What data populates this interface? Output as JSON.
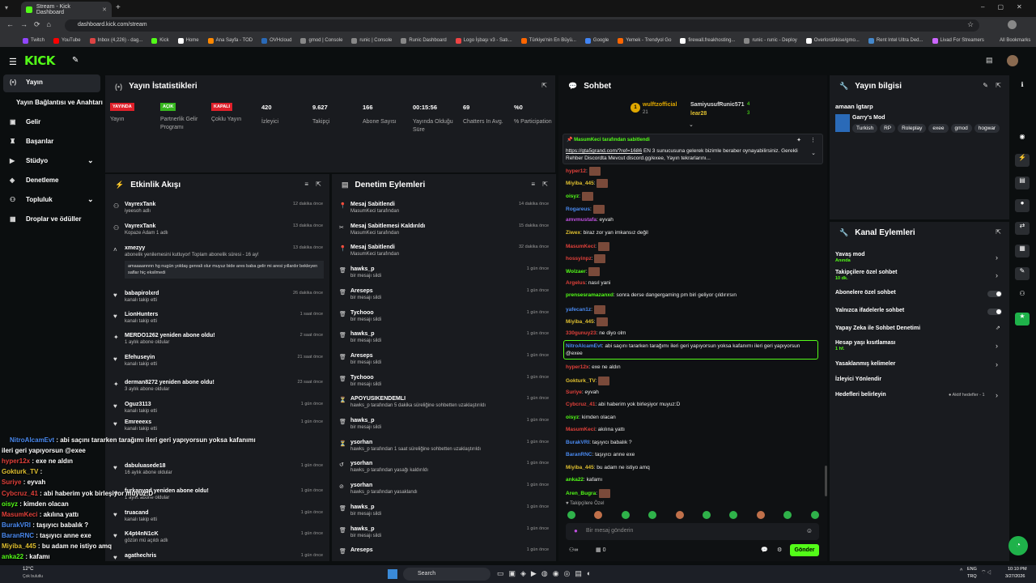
{
  "browser": {
    "tab_title": "Stream - Kick Dashboard",
    "url": "dashboard.kick.com/stream",
    "bookmarks": [
      "Twitch",
      "YouTube",
      "Inbox (4,226) - dag...",
      "Kick",
      "Home",
      "Ana Sayfa - TOD",
      "OVHcloud",
      "gmod | Console",
      "runic | Console",
      "Runic Dashboard",
      "Logo İşbaşı v3 - Satı...",
      "Türkiye'nin En Büyü...",
      "Google",
      "Yemek - Trendyol Go",
      "firewall.freakhosting...",
      "runic - runic - Deploy",
      "OverlordAkise/gmo...",
      "Rent Intel Ultra Ded...",
      "Livad For Streamers"
    ],
    "all_bookmarks": "All Bookmarks"
  },
  "brand": {
    "logo": "KICK",
    "accent": "#53fc18"
  },
  "sidebar": {
    "items": [
      {
        "label": "Yayın",
        "icon": "broadcast-icon"
      },
      {
        "label": "Yayın Bağlantısı ve Anahtarı",
        "icon": "key-icon"
      },
      {
        "label": "Gelir",
        "icon": "money-icon"
      },
      {
        "label": "Başarılar",
        "icon": "trophy-icon"
      },
      {
        "label": "Stüdyo",
        "icon": "studio-icon"
      },
      {
        "label": "Denetleme",
        "icon": "shield-icon"
      },
      {
        "label": "Topluluk",
        "icon": "users-icon"
      },
      {
        "label": "Droplar ve ödüller",
        "icon": "gift-icon"
      }
    ]
  },
  "stats": {
    "title": "Yayın İstatistikleri",
    "items": [
      {
        "badge": "YAYINDA",
        "label": "Yayın",
        "color": "#e0202a"
      },
      {
        "badge": "AÇIK",
        "label": "Partnerlik Gelir Programı",
        "color": "#36b71e"
      },
      {
        "badge": "KAPALI",
        "label": "Çoklu Yayın",
        "color": "#e0202a"
      },
      {
        "value": "420",
        "label": "İzleyici"
      },
      {
        "value": "9.627",
        "label": "Takipçi"
      },
      {
        "value": "166",
        "label": "Abone Sayısı"
      },
      {
        "value": "00:15:56",
        "label": "Yayında Olduğu Süre"
      },
      {
        "value": "69",
        "label": "Chatters In Avg."
      },
      {
        "value": "%0",
        "label": "% Participation"
      }
    ]
  },
  "activity": {
    "title": "Etkinlik Akışı",
    "items": [
      {
        "name": "VayrexTank",
        "sub": "iyeesoh adlı",
        "time": "12 dakika önce"
      },
      {
        "name": "VayrexTank",
        "sub": "Kopaze Adam 1 adlı",
        "time": "13 dakika önce"
      },
      {
        "name": "xmezyy",
        "sub": "abonelik yenilemesini kutluyor! Toplam abonelik süresi - 16 ay!",
        "time": "13 dakika önce",
        "msg": "amaaaannnn hg nugün yoldaş genrali olur muyuz bide ares baba gelir mi aresi yıllardır bekleyen saflar hiç eksilmedi"
      },
      {
        "name": "babapirolxrd",
        "sub": "kanalı takip etti",
        "time": "26 dakika önce"
      },
      {
        "name": "LionHunters",
        "sub": "kanalı takip etti",
        "time": "1 saat önce"
      },
      {
        "name": "MERDO1262 yeniden abone oldu!",
        "sub": "1 aylık abone oldular",
        "time": "2 saat önce"
      },
      {
        "name": "Efehuseyin",
        "sub": "kanalı takip etti",
        "time": "21 saat önce"
      },
      {
        "name": "derman8272 yeniden abone oldu!",
        "sub": "3 aylık abone oldular",
        "time": "23 saat önce"
      },
      {
        "name": "Oguz3113",
        "sub": "kanalı takip etti",
        "time": "1 gün önce"
      },
      {
        "name": "Emreeexs",
        "sub": "kanalı takip etti",
        "time": "1 gün önce"
      },
      {
        "name": "dabuluasede18",
        "sub": "16 aylık abone oldular",
        "time": "1 gün önce"
      },
      {
        "name": "furkanygd yeniden abone oldu!",
        "sub": "1 aylık abone oldular",
        "time": "1 gün önce"
      },
      {
        "name": "truacand",
        "sub": "kanalı takip etti",
        "time": "1 gün önce"
      },
      {
        "name": "K4pt4nN1cK",
        "sub": "gözün mü açıldı adlı",
        "time": "1 gün önce"
      },
      {
        "name": "agathechris",
        "sub": "",
        "time": "1 gün önce"
      }
    ]
  },
  "modlog": {
    "title": "Denetim Eylemleri",
    "items": [
      {
        "name": "Mesaj Sabitlendi",
        "sub": "MasumKeci tarafından",
        "time": "14 dakika önce",
        "icon": "pin-icon"
      },
      {
        "name": "Mesaj Sabitlemesi Kaldırıldı",
        "sub": "MasumKeci tarafından",
        "time": "15 dakika önce",
        "icon": "unpin-icon"
      },
      {
        "name": "Mesaj Sabitlendi",
        "sub": "MasumKeci tarafından",
        "time": "32 dakika önce",
        "icon": "pin-icon"
      },
      {
        "name": "hawks_p",
        "sub": "bir mesajı sildi",
        "time": "1 gün önce",
        "icon": "trash-icon"
      },
      {
        "name": "Areseps",
        "sub": "bir mesajı sildi",
        "time": "1 gün önce",
        "icon": "trash-icon"
      },
      {
        "name": "Tychooo",
        "sub": "bir mesajı sildi",
        "time": "1 gün önce",
        "icon": "trash-icon"
      },
      {
        "name": "hawks_p",
        "sub": "bir mesajı sildi",
        "time": "1 gün önce",
        "icon": "trash-icon"
      },
      {
        "name": "Areseps",
        "sub": "bir mesajı sildi",
        "time": "1 gün önce",
        "icon": "trash-icon"
      },
      {
        "name": "Tychooo",
        "sub": "bir mesajı sildi",
        "time": "1 gün önce",
        "icon": "trash-icon"
      },
      {
        "name": "APOYUSIKENDEMLI",
        "sub": "hawks_p tarafından 5 dakika süreliğine sohbetten uzaklaştırıldı",
        "time": "1 gün önce",
        "icon": "timeout-icon"
      },
      {
        "name": "hawks_p",
        "sub": "bir mesajı sildi",
        "time": "1 gün önce",
        "icon": "trash-icon"
      },
      {
        "name": "ysorhan",
        "sub": "hawks_p tarafından 1 saat süreliğine sohbetten uzaklaştırıldı",
        "time": "1 gün önce",
        "icon": "timeout-icon"
      },
      {
        "name": "ysorhan",
        "sub": "hawks_p tarafından yasağı kaldırıldı",
        "time": "1 gün önce",
        "icon": "unban-icon"
      },
      {
        "name": "ysorhan",
        "sub": "hawks_p tarafından yasaklandı",
        "time": "1 gün önce",
        "icon": "ban-icon"
      },
      {
        "name": "hawks_p",
        "sub": "bir mesajı sildi",
        "time": "1 gün önce",
        "icon": "trash-icon"
      },
      {
        "name": "hawks_p",
        "sub": "bir mesajı sildi",
        "time": "1 gün önce",
        "icon": "trash-icon"
      },
      {
        "name": "Areseps",
        "sub": "",
        "time": "1 gün önce",
        "icon": "trash-icon"
      }
    ]
  },
  "chat": {
    "title": "Sohbet",
    "top_gifter1": {
      "name": "wulftzofficial",
      "count": "21"
    },
    "top_gifter2": {
      "name": "SamiyusufRunic571",
      "count": "4"
    },
    "top_gifter3": {
      "name": "lear28",
      "count": "3"
    },
    "pinned_by": "MasumKeci tarafından sabitlendi",
    "pinned_link": "https://gta5grand.com/?ref=1686",
    "pinned_text": "EN 3 sunucusuna gelerek bizimle beraber oynayabilirsiniz. Gerekli Rehber Discordta Mevcut discord.gg/exee, Yayın tekrarlarını...",
    "messages": [
      {
        "user": "hyper12",
        "text": "",
        "color": "#e0403a"
      },
      {
        "user": "Miyiba_445",
        "text": "",
        "color": "#e0c030"
      },
      {
        "user": "oisyz",
        "text": "",
        "color": "#53fc18"
      },
      {
        "user": "Rogareus",
        "text": "",
        "color": "#4a8af0"
      },
      {
        "user": "amvmustafa",
        "text": "eyvah",
        "color": "#c050e0"
      },
      {
        "user": "Ziwex",
        "text": "biraz zor yan imkansız değil",
        "color": "#e0c030"
      },
      {
        "user": "MasumKeci",
        "text": "",
        "color": "#e0403a"
      },
      {
        "user": "hossyinpz",
        "text": "",
        "color": "#e0403a"
      },
      {
        "user": "Wolzaer",
        "text": "",
        "color": "#53fc18"
      },
      {
        "user": "Argelus",
        "text": "nasıl yani",
        "color": "#e0403a"
      },
      {
        "user": "prensesramazanxd",
        "text": "sonra derse dangergaming pm biri geliyor çıldırırsın",
        "color": "#53fc18"
      },
      {
        "user": "yafecan1z",
        "text": "",
        "color": "#4a8af0"
      },
      {
        "user": "Miyiba_445",
        "text": "",
        "color": "#e0c030"
      },
      {
        "user": "330gunuy23",
        "text": "ne diyo olm",
        "color": "#e0403a"
      },
      {
        "user": "NitroAlcamEvt",
        "text": "abi saçını tararken tarağımı ileri geri yapıyorsun yoksa kafanımı ileri geri yapıyorsun @exee",
        "color": "#4a8af0"
      },
      {
        "user": "hyper12x",
        "text": "exe ne aldın",
        "color": "#e0403a"
      },
      {
        "user": "Gokturk_TV",
        "text": "",
        "color": "#e0c030"
      },
      {
        "user": "Suriye",
        "text": "eyvah",
        "color": "#e0403a"
      },
      {
        "user": "Cybcruz_41",
        "text": "abi haberim yok birleşiyor muyuz:D",
        "color": "#e0403a"
      },
      {
        "user": "oisyz",
        "text": "kimden olacan",
        "color": "#53fc18"
      },
      {
        "user": "MasumKeci",
        "text": "akılına yattı",
        "color": "#e0403a"
      },
      {
        "user": "BurakVRI",
        "text": "taşıyıcı babalık ?",
        "color": "#4a8af0"
      },
      {
        "user": "BaranRNC",
        "text": "taşıyıcı anne exe",
        "color": "#4a8af0"
      },
      {
        "user": "Miyiba_445",
        "text": "bu adam ne istiyo amq",
        "color": "#e0c030"
      },
      {
        "user": "anka22",
        "text": "kafamı",
        "color": "#53fc18"
      },
      {
        "user": "Aren_Bugra",
        "text": "",
        "color": "#53fc18"
      }
    ],
    "followers_only": "Takipçilere Özel",
    "input_placeholder": "Bir mesaj gönderin",
    "count": "0",
    "send": "Gönder"
  },
  "overlay_chat": [
    {
      "user": "NitroAlcamEvt",
      "text": "abi saçını tararken tarağımı ileri geri yapıyorsun yoksa kafanımı",
      "color": "#4a8af0"
    },
    {
      "user": "",
      "text": "ileri geri yapıyorsun @exee",
      "color": "#fff"
    },
    {
      "user": "hyper12x",
      "text": "exe ne aldın",
      "color": "#e0403a"
    },
    {
      "user": "Gokturk_TV",
      "text": "",
      "color": "#e0c030"
    },
    {
      "user": "Suriye",
      "text": "eyvah",
      "color": "#e0403a"
    },
    {
      "user": "Cybcruz_41",
      "text": "abi haberim yok birleşiyor muyuz:D",
      "color": "#e0403a"
    },
    {
      "user": "oisyz",
      "text": "kimden olacan",
      "color": "#53fc18"
    },
    {
      "user": "MasumKeci",
      "text": "akılına yattı",
      "color": "#e0403a"
    },
    {
      "user": "BurakVRI",
      "text": "taşıyıcı babalık ?",
      "color": "#4a8af0"
    },
    {
      "user": "BaranRNC",
      "text": "taşıyıcı anne exe",
      "color": "#4a8af0"
    },
    {
      "user": "Miyiba_445",
      "text": "bu adam ne istiyo amq",
      "color": "#e0c030"
    },
    {
      "user": "anka22",
      "text": "kafamı",
      "color": "#53fc18"
    }
  ],
  "stream_info": {
    "title": "Yayın bilgisi",
    "stream_title": "amaan lgtarp",
    "category": "Garry's Mod",
    "tags": [
      "Turkish",
      "RP",
      "Roleplay",
      "exee",
      "gmod",
      "hogwar"
    ]
  },
  "channel_actions": {
    "title": "Kanal Eylemleri",
    "items": [
      {
        "label": "Yavaş mod",
        "sub": "Anında",
        "type": "chevron"
      },
      {
        "label": "Takipçilere özel sohbet",
        "sub": "10 dk.",
        "type": "chevron"
      },
      {
        "label": "Abonelere özel sohbet",
        "sub": "",
        "type": "toggle"
      },
      {
        "label": "Yalnızca ifadelerle sohbet",
        "sub": "",
        "type": "toggle"
      },
      {
        "label": "Yapay Zeka ile Sohbet Denetimi",
        "sub": "",
        "type": "external"
      },
      {
        "label": "Hesap yaşı kısıtlaması",
        "sub": "1 hf.",
        "type": "chevron"
      },
      {
        "label": "Yasaklanmış kelimeler",
        "sub": "",
        "type": "chevron"
      },
      {
        "label": "İzleyici Yönlendir",
        "sub": "",
        "type": "none"
      },
      {
        "label": "Hedefleri belirleyin",
        "sub": "",
        "type": "chevron",
        "extra": "Aktif hedefler - 1"
      }
    ]
  },
  "taskbar": {
    "weather_temp": "12°C",
    "weather_text": "Çok bulutlu",
    "search": "Search",
    "lang1": "ENG",
    "lang2": "TRQ",
    "time": "10:10 PM",
    "date": "3/27/2026"
  }
}
